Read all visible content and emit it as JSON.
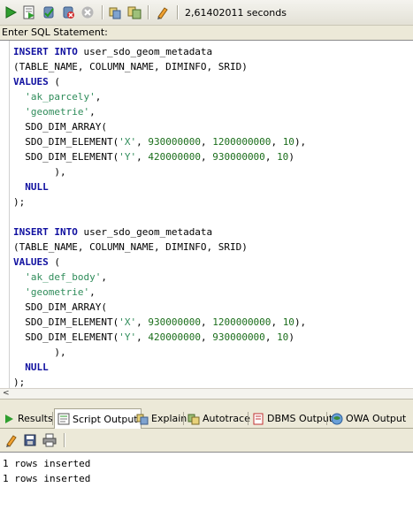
{
  "toolbar": {
    "buttons": [
      {
        "name": "run-statement-icon"
      },
      {
        "name": "run-script-icon"
      },
      {
        "name": "commit-icon"
      },
      {
        "name": "rollback-icon"
      },
      {
        "name": "cancel-icon"
      },
      {
        "name": "sql-history-icon"
      },
      {
        "name": "unshared-worksheet-icon"
      },
      {
        "name": "clear-icon"
      }
    ],
    "timing": "2,61402011 seconds"
  },
  "label": "Enter SQL Statement:",
  "editor": {
    "lines": [
      [
        {
          "t": "INSERT INTO",
          "c": "kw"
        },
        {
          "t": " user_sdo_geom_metadata",
          "c": "pl"
        }
      ],
      [
        {
          "t": "(TABLE_NAME, COLUMN_NAME, DIMINFO, SRID)",
          "c": "pl"
        }
      ],
      [
        {
          "t": "VALUES",
          "c": "kw"
        },
        {
          "t": " (",
          "c": "pl"
        }
      ],
      [
        {
          "t": "  ",
          "c": "pl"
        },
        {
          "t": "'ak_parcely'",
          "c": "str"
        },
        {
          "t": ",",
          "c": "pl"
        }
      ],
      [
        {
          "t": "  ",
          "c": "pl"
        },
        {
          "t": "'geometrie'",
          "c": "str"
        },
        {
          "t": ",",
          "c": "pl"
        }
      ],
      [
        {
          "t": "  SDO_DIM_ARRAY(",
          "c": "pl"
        }
      ],
      [
        {
          "t": "  SDO_DIM_ELEMENT(",
          "c": "pl"
        },
        {
          "t": "'X'",
          "c": "str"
        },
        {
          "t": ", ",
          "c": "pl"
        },
        {
          "t": "930000000",
          "c": "num"
        },
        {
          "t": ", ",
          "c": "pl"
        },
        {
          "t": "1200000000",
          "c": "num"
        },
        {
          "t": ", ",
          "c": "pl"
        },
        {
          "t": "10",
          "c": "num"
        },
        {
          "t": "),",
          "c": "pl"
        }
      ],
      [
        {
          "t": "  SDO_DIM_ELEMENT(",
          "c": "pl"
        },
        {
          "t": "'Y'",
          "c": "str"
        },
        {
          "t": ", ",
          "c": "pl"
        },
        {
          "t": "420000000",
          "c": "num"
        },
        {
          "t": ", ",
          "c": "pl"
        },
        {
          "t": "930000000",
          "c": "num"
        },
        {
          "t": ", ",
          "c": "pl"
        },
        {
          "t": "10",
          "c": "num"
        },
        {
          "t": ")",
          "c": "pl"
        }
      ],
      [
        {
          "t": "       ),",
          "c": "pl"
        }
      ],
      [
        {
          "t": "  ",
          "c": "pl"
        },
        {
          "t": "NULL",
          "c": "kw"
        }
      ],
      [
        {
          "t": ");",
          "c": "pl"
        }
      ],
      [
        {
          "t": "",
          "c": "pl"
        }
      ],
      [
        {
          "t": "INSERT INTO",
          "c": "kw"
        },
        {
          "t": " user_sdo_geom_metadata",
          "c": "pl"
        }
      ],
      [
        {
          "t": "(TABLE_NAME, COLUMN_NAME, DIMINFO, SRID)",
          "c": "pl"
        }
      ],
      [
        {
          "t": "VALUES",
          "c": "kw"
        },
        {
          "t": " (",
          "c": "pl"
        }
      ],
      [
        {
          "t": "  ",
          "c": "pl"
        },
        {
          "t": "'ak_def_body'",
          "c": "str"
        },
        {
          "t": ",",
          "c": "pl"
        }
      ],
      [
        {
          "t": "  ",
          "c": "pl"
        },
        {
          "t": "'geometrie'",
          "c": "str"
        },
        {
          "t": ",",
          "c": "pl"
        }
      ],
      [
        {
          "t": "  SDO_DIM_ARRAY(",
          "c": "pl"
        }
      ],
      [
        {
          "t": "  SDO_DIM_ELEMENT(",
          "c": "pl"
        },
        {
          "t": "'X'",
          "c": "str"
        },
        {
          "t": ", ",
          "c": "pl"
        },
        {
          "t": "930000000",
          "c": "num"
        },
        {
          "t": ", ",
          "c": "pl"
        },
        {
          "t": "1200000000",
          "c": "num"
        },
        {
          "t": ", ",
          "c": "pl"
        },
        {
          "t": "10",
          "c": "num"
        },
        {
          "t": "),",
          "c": "pl"
        }
      ],
      [
        {
          "t": "  SDO_DIM_ELEMENT(",
          "c": "pl"
        },
        {
          "t": "'Y'",
          "c": "str"
        },
        {
          "t": ", ",
          "c": "pl"
        },
        {
          "t": "420000000",
          "c": "num"
        },
        {
          "t": ", ",
          "c": "pl"
        },
        {
          "t": "930000000",
          "c": "num"
        },
        {
          "t": ", ",
          "c": "pl"
        },
        {
          "t": "10",
          "c": "num"
        },
        {
          "t": ")",
          "c": "pl"
        }
      ],
      [
        {
          "t": "       ),",
          "c": "pl"
        }
      ],
      [
        {
          "t": "  ",
          "c": "pl"
        },
        {
          "t": "NULL",
          "c": "kw"
        }
      ],
      [
        {
          "t": ");",
          "c": "pl"
        }
      ]
    ]
  },
  "scrollbar": {
    "left_arrow": "<"
  },
  "tabs": [
    {
      "label": "Results",
      "icon": "results-icon",
      "active": false
    },
    {
      "label": "Script Output",
      "icon": "script-output-icon",
      "active": true
    },
    {
      "label": "Explain",
      "icon": "explain-icon",
      "active": false
    },
    {
      "label": "Autotrace",
      "icon": "autotrace-icon",
      "active": false
    },
    {
      "label": "DBMS Output",
      "icon": "dbms-output-icon",
      "active": false
    },
    {
      "label": "OWA Output",
      "icon": "owa-output-icon",
      "active": false
    }
  ],
  "output_toolbar": {
    "buttons": [
      {
        "name": "clear-output-icon"
      },
      {
        "name": "save-icon"
      },
      {
        "name": "print-icon"
      }
    ]
  },
  "output": {
    "lines": [
      "1 rows inserted",
      "1 rows inserted"
    ]
  },
  "colors": {
    "keyword": "#1010a0",
    "string": "#2f8c5a",
    "number": "#1b6e1b"
  }
}
